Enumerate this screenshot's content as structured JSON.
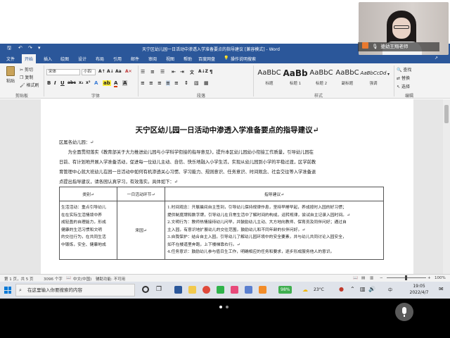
{
  "window": {
    "title": "天宁区幼儿园一日活动中渗透入学准备要点的指导建议 [兼容模式] - Word"
  },
  "menu_tabs": [
    "文件",
    "开始",
    "插入",
    "绘图",
    "设计",
    "布局",
    "引用",
    "邮件",
    "审阅",
    "视图",
    "帮助",
    "百度网盘"
  ],
  "tell_me": "操作说明搜索",
  "user_label": "婆幼王翔老师",
  "ribbon": {
    "clipboard": {
      "paste": "粘贴",
      "cut": "剪切",
      "copy": "复制",
      "format_painter": "格式刷",
      "label": "剪贴板"
    },
    "font": {
      "font_name": "宋体",
      "font_size": "小四",
      "label": "字体"
    },
    "paragraph": {
      "label": "段落"
    },
    "styles": {
      "label": "样式",
      "items": [
        {
          "sample": "AaBbC",
          "name": "标题"
        },
        {
          "sample": "AaBb",
          "name": "标题 1"
        },
        {
          "sample": "AaBbC",
          "name": "标题 2"
        },
        {
          "sample": "AaBbC",
          "name": "副标题"
        },
        {
          "sample": "AaBbCcDd",
          "name": "强调"
        }
      ]
    },
    "editing": {
      "find": "查找",
      "replace": "替换",
      "select": "选择",
      "label": "编辑"
    }
  },
  "document": {
    "title": "天宁区幼儿园一日活动中渗透入学准备要点的指导建议↵",
    "lines": [
      "区属各幼儿园：↵",
      "　　为全面贯彻落实《教育部关于大力推进幼儿园与小学科学衔接的指导意见》，提升本区幼儿园幼小衔接工作质量，引导幼儿园在",
      "日前、有计划地开展入学准备活动，促进每一位幼儿主动、自信、快乐地融入小学生活，实现从幼儿园到小学的平稳过渡，区学前教",
      "育管理中心就大班幼儿在园一日活动中如何有机渗透关心习惯、学习能力、规则意识、任务意识、时间观念、社会交往等入学准备退",
      "点提出指导建议，请各园认真学习，有效落实。具体如下：↵"
    ],
    "table": {
      "headers": [
        "类别↵",
        "一日活动环节↵",
        "指导建议↵"
      ],
      "row1": {
        "category_lines": [
          "生活活动：重点引导幼儿",
          "在在实际生活情境中养",
          "成轻盈的自理能力，形成",
          "健康的生活习惯和文明",
          "的交往行为，在共同生活",
          "中锻炼，安全、健康地成"
        ],
        "phase": "来园↵",
        "advice_lines": [
          "1.时间观念：开展晨间自主签到，引导幼儿保持规律作息，坚持早睡早起，养成按时入园的好习惯；",
          "提供制度牌和数字牌，引导幼儿在日常生活中了解时间的构成，运转规律，尝试自主记录入园时间。↵",
          "2.文明行为：教师热情接待幼儿问早，并鼓励幼儿主动、大方地向教师、保育员及同伴问好；通过自",
          "主入园，有意识地扩展幼儿的交往范围，鼓励幼儿和不同年龄的伙伴问好。↵",
          "3.自我保护：结合自主入园，引导幼儿了解幼儿园环境中的安全要素，并与幼儿共同讨论入园安全，",
          "如不在楼道里奔跑，上下楼梯靠右行。↵",
          "4.任务意识：鼓励幼儿参与值日生工作，明确相应的任务和要求，逐步形成服务他人的意识。"
        ]
      }
    }
  },
  "status": {
    "page": "第 1 页，共 5 页",
    "words": "3096 个字",
    "language": "中文(中国)",
    "accessibility": "辅助功能: 不可用",
    "zoom": "100%"
  },
  "taskbar": {
    "search_placeholder": "在这里输入你要搜索的内容",
    "battery": "98%",
    "temperature": "23°C",
    "time": "19:05",
    "date": "2022/4/7",
    "lang": "中"
  },
  "colors": {
    "word_blue": "#2b579a",
    "ribbon_bg": "#f3f3f3",
    "doc_bg": "#e6e6e6",
    "mic_button": "#5a5a5a"
  }
}
